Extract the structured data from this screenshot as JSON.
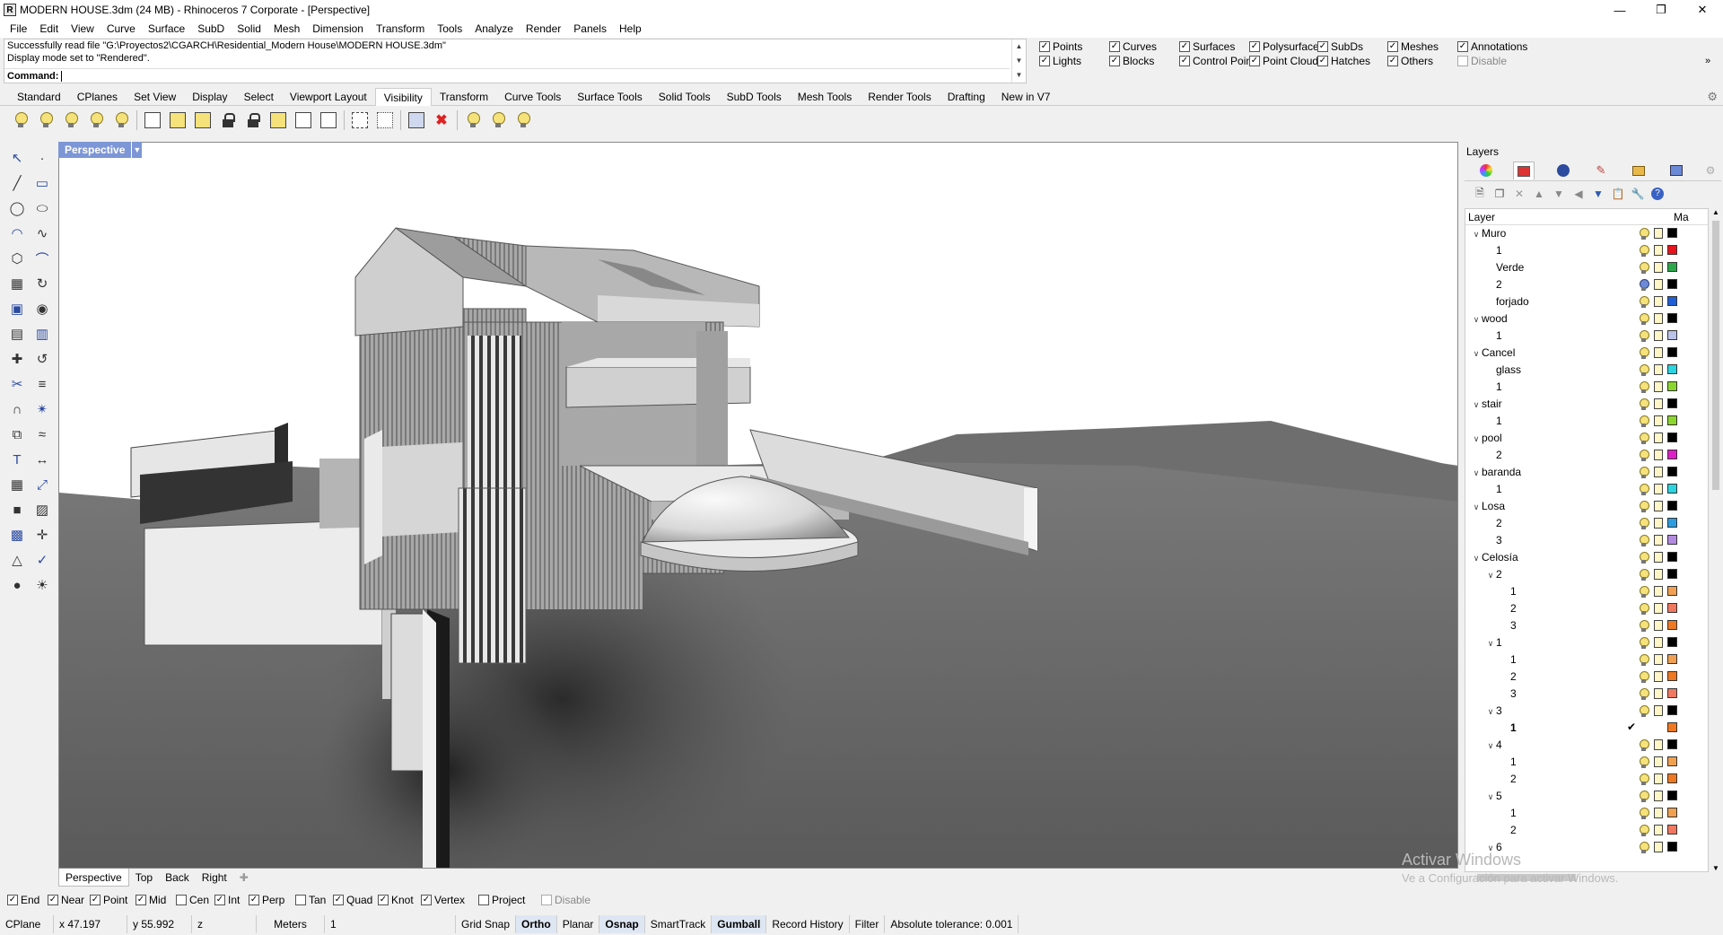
{
  "window": {
    "title": "MODERN HOUSE.3dm (24 MB) - Rhinoceros 7 Corporate - [Perspective]",
    "app_icon": "rhino-icon",
    "controls": [
      "minimize-icon",
      "restore-icon",
      "close-icon"
    ]
  },
  "menu": [
    "File",
    "Edit",
    "View",
    "Curve",
    "Surface",
    "SubD",
    "Solid",
    "Mesh",
    "Dimension",
    "Transform",
    "Tools",
    "Analyze",
    "Render",
    "Panels",
    "Help"
  ],
  "command": {
    "history": [
      "Successfully read file \"G:\\Proyectos2\\CGARCH\\Residential_Modern House\\MODERN HOUSE.3dm\"",
      "Display mode set to \"Rendered\"."
    ],
    "prompt": "Command:",
    "value": ""
  },
  "select_filter": {
    "row1": [
      {
        "label": "Points",
        "checked": true
      },
      {
        "label": "Curves",
        "checked": true
      },
      {
        "label": "Surfaces",
        "checked": true
      },
      {
        "label": "Polysurfaces",
        "checked": true
      },
      {
        "label": "SubDs",
        "checked": true
      },
      {
        "label": "Meshes",
        "checked": true
      },
      {
        "label": "Annotations",
        "checked": true
      }
    ],
    "row2": [
      {
        "label": "Lights",
        "checked": true
      },
      {
        "label": "Blocks",
        "checked": true
      },
      {
        "label": "Control Points",
        "checked": true
      },
      {
        "label": "Point Clouds",
        "checked": true
      },
      {
        "label": "Hatches",
        "checked": true
      },
      {
        "label": "Others",
        "checked": true
      },
      {
        "label": "Disable",
        "checked": false
      }
    ]
  },
  "toolbar_tabs": [
    "Standard",
    "CPlanes",
    "Set View",
    "Display",
    "Select",
    "Viewport Layout",
    "Visibility",
    "Transform",
    "Curve Tools",
    "Surface Tools",
    "Solid Tools",
    "SubD Tools",
    "Mesh Tools",
    "Render Tools",
    "Drafting",
    "New in V7"
  ],
  "active_tab": "Visibility",
  "viewport": {
    "title": "Perspective",
    "tabs": [
      "Perspective",
      "Top",
      "Back",
      "Right"
    ],
    "active_tab": "Perspective"
  },
  "osnap": [
    {
      "label": "End",
      "checked": true
    },
    {
      "label": "Near",
      "checked": true
    },
    {
      "label": "Point",
      "checked": true
    },
    {
      "label": "Mid",
      "checked": true
    },
    {
      "label": "Cen",
      "checked": false
    },
    {
      "label": "Int",
      "checked": true
    },
    {
      "label": "Perp",
      "checked": true
    },
    {
      "label": "Tan",
      "checked": false
    },
    {
      "label": "Quad",
      "checked": true
    },
    {
      "label": "Knot",
      "checked": true
    },
    {
      "label": "Vertex",
      "checked": true
    },
    {
      "label": "Project",
      "checked": false
    },
    {
      "label": "Disable",
      "checked": false
    }
  ],
  "status": {
    "cplane": "CPlane",
    "x": "x 47.197",
    "y": "y 55.992",
    "z": "z",
    "units": "Meters",
    "layer": "1",
    "toggles": [
      {
        "label": "Grid Snap",
        "on": false
      },
      {
        "label": "Ortho",
        "on": true
      },
      {
        "label": "Planar",
        "on": false
      },
      {
        "label": "Osnap",
        "on": true
      },
      {
        "label": "SmartTrack",
        "on": false
      },
      {
        "label": "Gumball",
        "on": true
      },
      {
        "label": "Record History",
        "on": false
      },
      {
        "label": "Filter",
        "on": false
      }
    ],
    "tolerance": "Absolute tolerance: 0.001"
  },
  "layers_panel": {
    "title": "Layers",
    "col_layer": "Layer",
    "col_material": "Ma",
    "rows": [
      {
        "name": "Muro",
        "depth": 0,
        "expanded": true,
        "color": "#000000"
      },
      {
        "name": "1",
        "depth": 1,
        "color": "#e8141c"
      },
      {
        "name": "Verde",
        "depth": 1,
        "color": "#2aa84a"
      },
      {
        "name": "2",
        "depth": 1,
        "color": "#000000",
        "bulb": "blue"
      },
      {
        "name": "forjado",
        "depth": 1,
        "color": "#1f5fd6"
      },
      {
        "name": "wood",
        "depth": 0,
        "expanded": true,
        "color": "#000000"
      },
      {
        "name": "1",
        "depth": 1,
        "color": "#b9c4e8"
      },
      {
        "name": "Cancel",
        "depth": 0,
        "expanded": true,
        "color": "#000000"
      },
      {
        "name": "glass",
        "depth": 1,
        "color": "#2ad4e0"
      },
      {
        "name": "1",
        "depth": 1,
        "color": "#8ad62a"
      },
      {
        "name": "stair",
        "depth": 0,
        "expanded": true,
        "color": "#000000"
      },
      {
        "name": "1",
        "depth": 1,
        "color": "#8ad62a"
      },
      {
        "name": "pool",
        "depth": 0,
        "expanded": true,
        "color": "#000000"
      },
      {
        "name": "2",
        "depth": 1,
        "color": "#e01ec8"
      },
      {
        "name": "baranda",
        "depth": 0,
        "expanded": true,
        "color": "#000000"
      },
      {
        "name": "1",
        "depth": 1,
        "color": "#2ad4e0"
      },
      {
        "name": "Losa",
        "depth": 0,
        "expanded": true,
        "color": "#000000"
      },
      {
        "name": "2",
        "depth": 1,
        "color": "#2a9ee0"
      },
      {
        "name": "3",
        "depth": 1,
        "color": "#b48ae0"
      },
      {
        "name": "Celosía",
        "depth": 0,
        "expanded": true,
        "color": "#000000"
      },
      {
        "name": "2",
        "depth": 1,
        "expanded": true,
        "color": "#000000"
      },
      {
        "name": "1",
        "depth": 2,
        "color": "#f0a050"
      },
      {
        "name": "2",
        "depth": 2,
        "color": "#f07860"
      },
      {
        "name": "3",
        "depth": 2,
        "color": "#f07820"
      },
      {
        "name": "1",
        "depth": 1,
        "expanded": true,
        "color": "#000000"
      },
      {
        "name": "1",
        "depth": 2,
        "color": "#f0a050"
      },
      {
        "name": "2",
        "depth": 2,
        "color": "#f07820"
      },
      {
        "name": "3",
        "depth": 2,
        "color": "#f07860"
      },
      {
        "name": "3",
        "depth": 1,
        "expanded": true,
        "color": "#000000"
      },
      {
        "name": "1",
        "depth": 2,
        "color": "#f07820",
        "current": true
      },
      {
        "name": "4",
        "depth": 1,
        "expanded": true,
        "color": "#000000"
      },
      {
        "name": "1",
        "depth": 2,
        "color": "#f0a050"
      },
      {
        "name": "2",
        "depth": 2,
        "color": "#f07820"
      },
      {
        "name": "5",
        "depth": 1,
        "expanded": true,
        "color": "#000000"
      },
      {
        "name": "1",
        "depth": 2,
        "color": "#f0a050"
      },
      {
        "name": "2",
        "depth": 2,
        "color": "#f07860"
      },
      {
        "name": "6",
        "depth": 1,
        "expanded": true,
        "color": "#000000"
      }
    ]
  },
  "watermark": {
    "line1": "Activar Windows",
    "line2": "Ve a Configuración para activar Windows."
  }
}
